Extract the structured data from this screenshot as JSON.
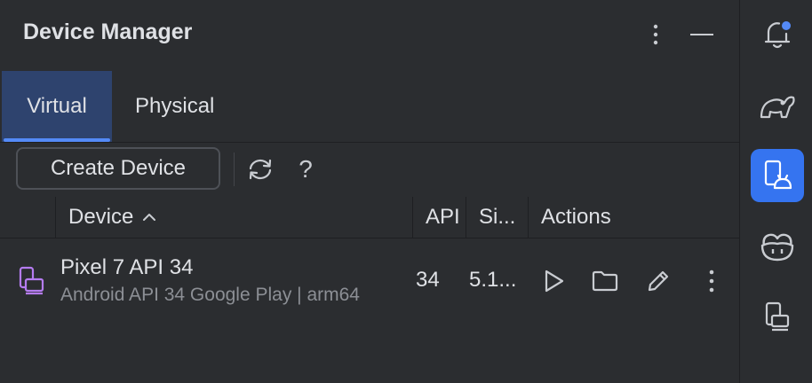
{
  "header": {
    "title": "Device Manager"
  },
  "tabs": [
    {
      "label": "Virtual",
      "active": true
    },
    {
      "label": "Physical",
      "active": false
    }
  ],
  "toolbar": {
    "create_label": "Create Device",
    "help_glyph": "?"
  },
  "table": {
    "columns": [
      "Device",
      "API",
      "Si...",
      "Actions"
    ],
    "rows": [
      {
        "name": "Pixel 7 API 34",
        "subtitle": "Android API 34 Google Play | arm64",
        "api": "34",
        "size": "5.1..."
      }
    ]
  },
  "colors": {
    "accent": "#3574f0",
    "tab_active_bg": "#2e436e",
    "tab_underline": "#548af7",
    "background": "#2b2d30",
    "device_icon": "#b57cf0"
  },
  "icons": {
    "header": [
      "more-vert-icon",
      "minimize-icon"
    ],
    "toolbar": [
      "refresh-icon",
      "help-icon"
    ],
    "row_actions": [
      "play-icon",
      "folder-icon",
      "edit-icon",
      "more-vert-icon"
    ],
    "right_bar": [
      "notifications-icon",
      "gradle-elephant-icon",
      "device-manager-icon",
      "copilot-icon",
      "running-devices-icon"
    ]
  }
}
